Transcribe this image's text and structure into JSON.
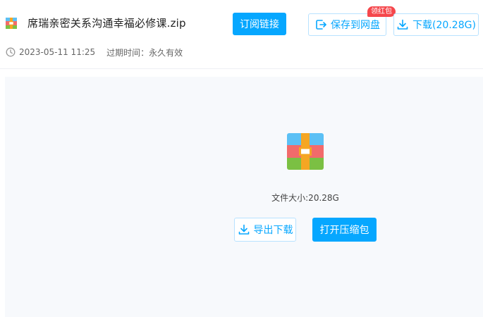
{
  "file": {
    "name": "席瑞亲密关系沟通幸福必修课.zip",
    "icon": "zip-archive-icon"
  },
  "header": {
    "subscribe_label": "订阅链接",
    "save_label": "保存到网盘",
    "badge_label": "领红包",
    "download_label": "下载(20.28G)"
  },
  "meta": {
    "date": "2023-05-11 11:25",
    "expiry": "过期时间：永久有效"
  },
  "preview": {
    "size_text": "文件大小:20.28G",
    "export_label": "导出下载",
    "open_label": "打开压缩包"
  },
  "colors": {
    "accent": "#06a7ff",
    "badge": "#f5474c",
    "panel_bg": "#f7f9fc"
  }
}
